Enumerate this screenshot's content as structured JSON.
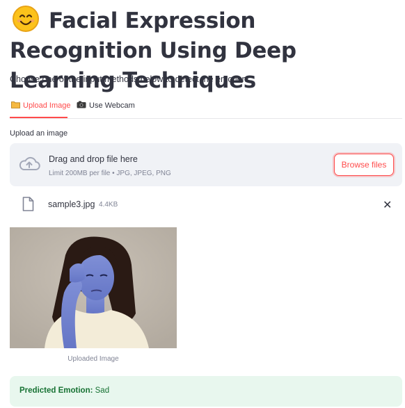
{
  "header": {
    "emoji_icon": "smiling-face-emoji",
    "title": "Facial Expression Recognition Using Deep Learning Techniques",
    "subtitle": "Choose one of the input methods below to detect the emotion."
  },
  "tabs": [
    {
      "label": "Upload Image",
      "icon": "folder-icon",
      "active": true
    },
    {
      "label": "Use Webcam",
      "icon": "camera-icon",
      "active": false
    }
  ],
  "uploader": {
    "label": "Upload an image",
    "drop_text": "Drag and drop file here",
    "limit_text": "Limit 200MB per file • JPG, JPEG, PNG",
    "browse_label": "Browse files"
  },
  "file": {
    "name": "sample3.jpg",
    "size": "4.4KB"
  },
  "image": {
    "caption": "Uploaded Image"
  },
  "result": {
    "label": "Predicted Emotion:",
    "value": "Sad"
  },
  "colors": {
    "accent": "#ff4b4b",
    "success_bg": "#e8f7ee",
    "success_text": "#177233"
  }
}
